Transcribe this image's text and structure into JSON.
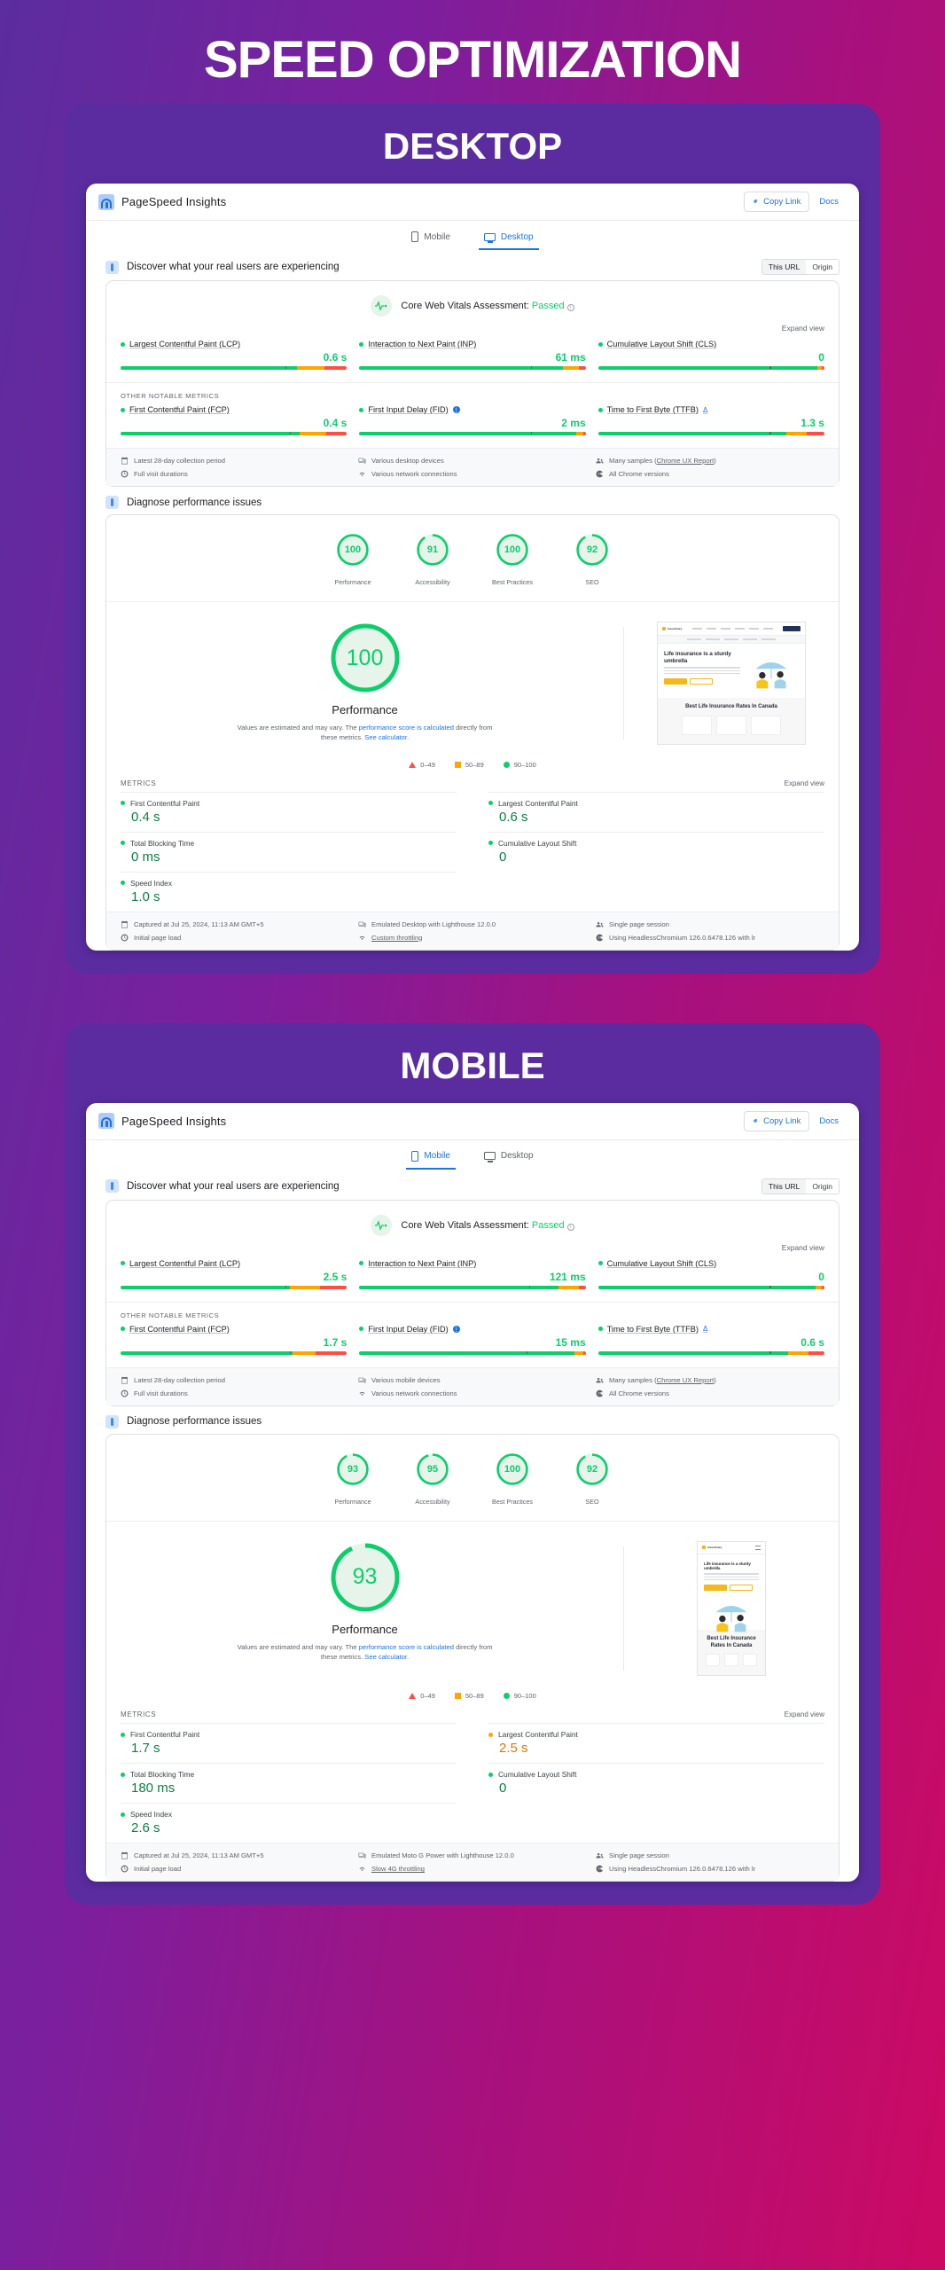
{
  "page": {
    "title": "SPEED OPTIMIZATION"
  },
  "sections": [
    {
      "label": "DESKTOP",
      "brand": "PageSpeed Insights",
      "copy_link": "Copy Link",
      "docs": "Docs",
      "tabs": [
        {
          "label": "Mobile",
          "active": false
        },
        {
          "label": "Desktop",
          "active": true
        }
      ],
      "field": {
        "heading": "Discover what your real users are experiencing",
        "toggle": [
          "This URL",
          "Origin"
        ],
        "assessment_label": "Core Web Vitals Assessment:",
        "assessment_value": "Passed",
        "expand": "Expand view",
        "other_metrics_label": "OTHER NOTABLE METRICS",
        "core": [
          {
            "name": "Largest Contentful Paint (LCP)",
            "value": "0.6 s",
            "status": "green",
            "pos": 72,
            "green": 78,
            "orange": 12,
            "red": 10
          },
          {
            "name": "Interaction to Next Paint (INP)",
            "value": "61 ms",
            "status": "green",
            "pos": 75,
            "green": 90,
            "orange": 7,
            "red": 3
          },
          {
            "name": "Cumulative Layout Shift (CLS)",
            "value": "0",
            "status": "green",
            "pos": 75,
            "green": 97,
            "orange": 2,
            "red": 1
          }
        ],
        "other": [
          {
            "name": "First Contentful Paint (FCP)",
            "value": "0.4 s",
            "status": "green",
            "pos": 74,
            "green": 79,
            "orange": 12,
            "red": 9,
            "badge": ""
          },
          {
            "name": "First Input Delay (FID)",
            "value": "2 ms",
            "status": "green",
            "pos": 75,
            "green": 96,
            "orange": 3,
            "red": 1,
            "badge": "i"
          },
          {
            "name": "Time to First Byte (TTFB)",
            "value": "1.3 s",
            "status": "green",
            "pos": 75,
            "green": 83,
            "orange": 9,
            "red": 8,
            "badge": "delta"
          }
        ],
        "footnotes": [
          {
            "icon": "calendar-icon",
            "text": "Latest 28-day collection period"
          },
          {
            "icon": "devices-icon",
            "text": "Various desktop devices"
          },
          {
            "icon": "samples-icon",
            "text": "Many samples (",
            "link": "Chrome UX Report",
            "after": ")"
          },
          {
            "icon": "clock-icon",
            "text": "Full visit durations"
          },
          {
            "icon": "wifi-icon",
            "text": "Various network connections"
          },
          {
            "icon": "chrome-icon",
            "text": "All Chrome versions"
          }
        ]
      },
      "lab": {
        "heading": "Diagnose performance issues",
        "scores": [
          {
            "label": "Performance",
            "value": "100"
          },
          {
            "label": "Accessibility",
            "value": "91"
          },
          {
            "label": "Best Practices",
            "value": "100"
          },
          {
            "label": "SEO",
            "value": "92"
          }
        ],
        "perf_score": "100",
        "perf_label": "Performance",
        "perf_note_1": "Values are estimated and may vary. The ",
        "perf_note_link_1": "performance score is calculated",
        "perf_note_2": " directly from these metrics. ",
        "perf_note_link_2": "See calculator.",
        "legend": [
          "0–49",
          "50–89",
          "90–100"
        ],
        "metrics_label": "METRICS",
        "expand": "Expand view",
        "metrics": [
          {
            "name": "First Contentful Paint",
            "value": "0.4 s",
            "status": "green"
          },
          {
            "name": "Largest Contentful Paint",
            "value": "0.6 s",
            "status": "green"
          },
          {
            "name": "Total Blocking Time",
            "value": "0 ms",
            "status": "green"
          },
          {
            "name": "Cumulative Layout Shift",
            "value": "0",
            "status": "green"
          },
          {
            "name": "Speed Index",
            "value": "1.0 s",
            "status": "green"
          }
        ],
        "footnotes": [
          {
            "icon": "calendar-icon",
            "text": "Captured at Jul 25, 2024, 11:13 AM GMT+5"
          },
          {
            "icon": "devices-icon",
            "text": "Emulated Desktop with Lighthouse 12.0.0"
          },
          {
            "icon": "samples-icon",
            "text": "Single page session"
          },
          {
            "icon": "clock-icon",
            "text": "Initial page load"
          },
          {
            "icon": "wifi-icon",
            "text": "Custom throttling",
            "link": true
          },
          {
            "icon": "chrome-icon",
            "text": "Using HeadlessChromium 126.0.6478.126 with lr"
          }
        ]
      },
      "thumbnail": {
        "site_name": "Insurdinary",
        "headline": "Life insurance is a sturdy umbrella",
        "headline_tail": " - Often overlooked in fair weather but priceless protection when life storms hit.",
        "cta_primary": "Get a Quote",
        "cta_secondary": "Learn More",
        "band_title": "Best Life Insurance Rates In Canada"
      }
    },
    {
      "label": "MOBILE",
      "brand": "PageSpeed Insights",
      "copy_link": "Copy Link",
      "docs": "Docs",
      "tabs": [
        {
          "label": "Mobile",
          "active": true
        },
        {
          "label": "Desktop",
          "active": false
        }
      ],
      "field": {
        "heading": "Discover what your real users are experiencing",
        "toggle": [
          "This URL",
          "Origin"
        ],
        "assessment_label": "Core Web Vitals Assessment:",
        "assessment_value": "Passed",
        "expand": "Expand view",
        "other_metrics_label": "OTHER NOTABLE METRICS",
        "core": [
          {
            "name": "Largest Contentful Paint (LCP)",
            "value": "2.5 s",
            "status": "green",
            "pos": 72,
            "green": 75,
            "orange": 13,
            "red": 12
          },
          {
            "name": "Interaction to Next Paint (INP)",
            "value": "121 ms",
            "status": "green",
            "pos": 74,
            "green": 88,
            "orange": 9,
            "red": 3
          },
          {
            "name": "Cumulative Layout Shift (CLS)",
            "value": "0",
            "status": "green",
            "pos": 75,
            "green": 96,
            "orange": 3,
            "red": 1
          }
        ],
        "other": [
          {
            "name": "First Contentful Paint (FCP)",
            "value": "1.7 s",
            "status": "green",
            "pos": 74,
            "green": 76,
            "orange": 10,
            "red": 14,
            "badge": ""
          },
          {
            "name": "First Input Delay (FID)",
            "value": "15 ms",
            "status": "green",
            "pos": 73,
            "green": 95,
            "orange": 4,
            "red": 1,
            "badge": "i"
          },
          {
            "name": "Time to First Byte (TTFB)",
            "value": "0.6 s",
            "status": "green",
            "pos": 75,
            "green": 84,
            "orange": 9,
            "red": 7,
            "badge": "delta"
          }
        ],
        "footnotes": [
          {
            "icon": "calendar-icon",
            "text": "Latest 28-day collection period"
          },
          {
            "icon": "devices-icon",
            "text": "Various mobile devices"
          },
          {
            "icon": "samples-icon",
            "text": "Many samples (",
            "link": "Chrome UX Report",
            "after": ")"
          },
          {
            "icon": "clock-icon",
            "text": "Full visit durations"
          },
          {
            "icon": "wifi-icon",
            "text": "Various network connections"
          },
          {
            "icon": "chrome-icon",
            "text": "All Chrome versions"
          }
        ]
      },
      "lab": {
        "heading": "Diagnose performance issues",
        "scores": [
          {
            "label": "Performance",
            "value": "93"
          },
          {
            "label": "Accessibility",
            "value": "95"
          },
          {
            "label": "Best Practices",
            "value": "100"
          },
          {
            "label": "SEO",
            "value": "92"
          }
        ],
        "perf_score": "93",
        "perf_label": "Performance",
        "perf_note_1": "Values are estimated and may vary. The ",
        "perf_note_link_1": "performance score is calculated",
        "perf_note_2": " directly from these metrics. ",
        "perf_note_link_2": "See calculator.",
        "legend": [
          "0–49",
          "50–89",
          "90–100"
        ],
        "metrics_label": "METRICS",
        "expand": "Expand view",
        "metrics": [
          {
            "name": "First Contentful Paint",
            "value": "1.7 s",
            "status": "green"
          },
          {
            "name": "Largest Contentful Paint",
            "value": "2.5 s",
            "status": "orange"
          },
          {
            "name": "Total Blocking Time",
            "value": "180 ms",
            "status": "green"
          },
          {
            "name": "Cumulative Layout Shift",
            "value": "0",
            "status": "green"
          },
          {
            "name": "Speed Index",
            "value": "2.6 s",
            "status": "green"
          }
        ],
        "footnotes": [
          {
            "icon": "calendar-icon",
            "text": "Captured at Jul 25, 2024, 11:13 AM GMT+5"
          },
          {
            "icon": "devices-icon",
            "text": "Emulated Moto G Power with Lighthouse 12.0.0"
          },
          {
            "icon": "samples-icon",
            "text": "Single page session"
          },
          {
            "icon": "clock-icon",
            "text": "Initial page load"
          },
          {
            "icon": "wifi-icon",
            "text": "Slow 4G throttling",
            "link": true
          },
          {
            "icon": "chrome-icon",
            "text": "Using HeadlessChromium 126.0.6478.126 with lr"
          }
        ]
      },
      "thumbnail": {
        "site_name": "Insurdinary",
        "headline": "Life insurance is a sturdy umbrella",
        "headline_tail": " - Often overlooked in fair weather but priceless protection when life storms hit.",
        "cta_primary": "Get a Quote",
        "cta_secondary": "Learn More",
        "band_title": "Best Life Insurance Rates In Canada"
      }
    }
  ],
  "colors": {
    "green": "#0cce6b",
    "orange": "#ffa400",
    "red": "#ff4e42",
    "blue": "#1a73e8",
    "purple": "#5a2ca0"
  }
}
